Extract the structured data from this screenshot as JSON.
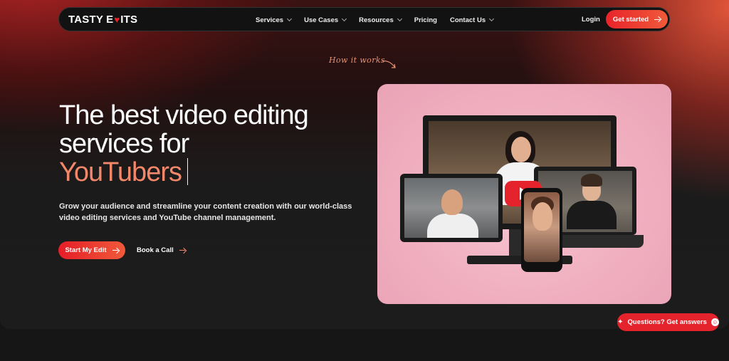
{
  "brand": {
    "name_part1": "TASTY E",
    "name_heart": "♥",
    "name_part2": "ITS"
  },
  "nav": {
    "items": [
      {
        "label": "Services",
        "has_dropdown": true
      },
      {
        "label": "Use Cases",
        "has_dropdown": true
      },
      {
        "label": "Resources",
        "has_dropdown": true
      },
      {
        "label": "Pricing",
        "has_dropdown": false
      },
      {
        "label": "Contact Us",
        "has_dropdown": true
      }
    ],
    "login_label": "Login",
    "cta_label": "Get started"
  },
  "hero": {
    "how_it_works": "How it works",
    "headline_line1": "The best video editing",
    "headline_line2": "services for",
    "headline_accent": "YouTubers",
    "subtitle": "Grow your audience and streamline your content creation with our world-class video editing services and YouTube channel management.",
    "primary_button": "Start My Edit",
    "secondary_button": "Book a Call"
  },
  "chat_widget": {
    "label": "Questions? Get answers",
    "star": "✦",
    "emoji": "☺"
  },
  "colors": {
    "accent_red": "#e4232c",
    "accent_coral": "#f2876a",
    "media_pink": "#f1b2c2",
    "nav_bg": "#121212"
  }
}
